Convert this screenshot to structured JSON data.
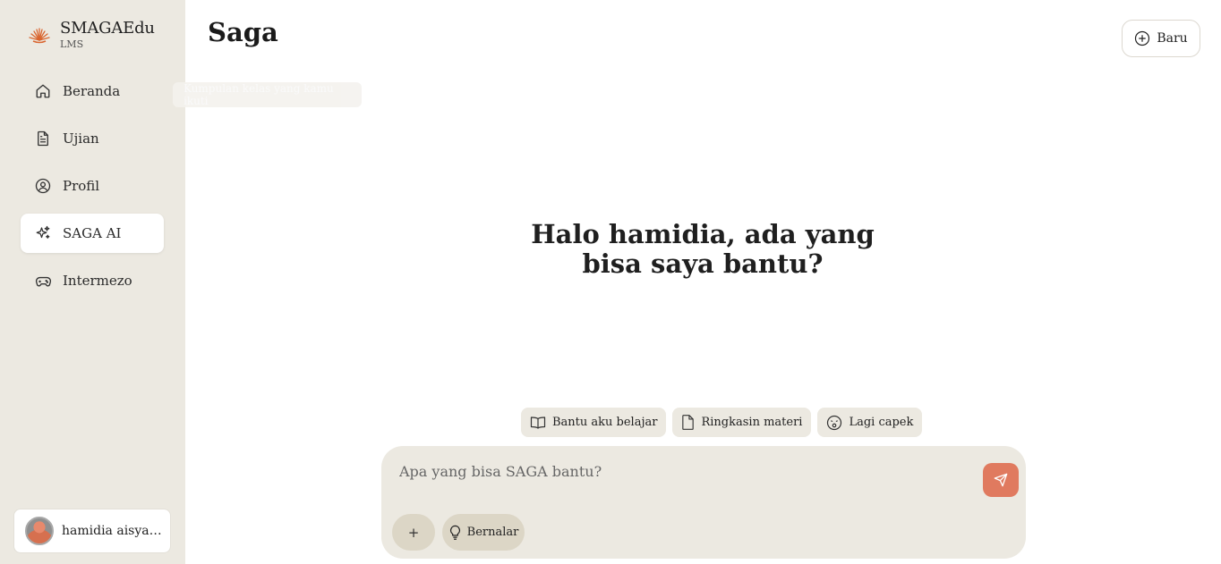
{
  "brand": {
    "name": "SMAGAEdu",
    "subtitle": "LMS"
  },
  "sidebar": {
    "items": [
      {
        "label": "Beranda",
        "icon": "home-icon",
        "active": false
      },
      {
        "label": "Ujian",
        "icon": "document-icon",
        "active": false
      },
      {
        "label": "Profil",
        "icon": "user-circle-icon",
        "active": false
      },
      {
        "label": "SAGA AI",
        "icon": "sparkles-icon",
        "active": true
      },
      {
        "label": "Intermezo",
        "icon": "gamepad-icon",
        "active": false
      }
    ],
    "tooltip": "Kumpulan kelas yang kamu ikuti"
  },
  "user": {
    "name": "hamidia aisya r..."
  },
  "header": {
    "title": "Saga",
    "new_label": "Baru"
  },
  "main": {
    "greeting_line1": "Halo hamidia, ada yang",
    "greeting_line2": "bisa saya bantu?"
  },
  "suggestions": [
    {
      "label": "Bantu aku belajar",
      "icon": "book-icon"
    },
    {
      "label": "Ringkasin materi",
      "icon": "file-icon"
    },
    {
      "label": "Lagi capek",
      "icon": "tired-face-icon"
    }
  ],
  "composer": {
    "placeholder": "Apa yang bisa SAGA bantu?",
    "add_label": "+",
    "reason_label": "Bernalar"
  },
  "colors": {
    "sidebar_bg": "#ECE9E1",
    "accent": "#E07A5F",
    "pill_bg": "#DCD6C6"
  }
}
